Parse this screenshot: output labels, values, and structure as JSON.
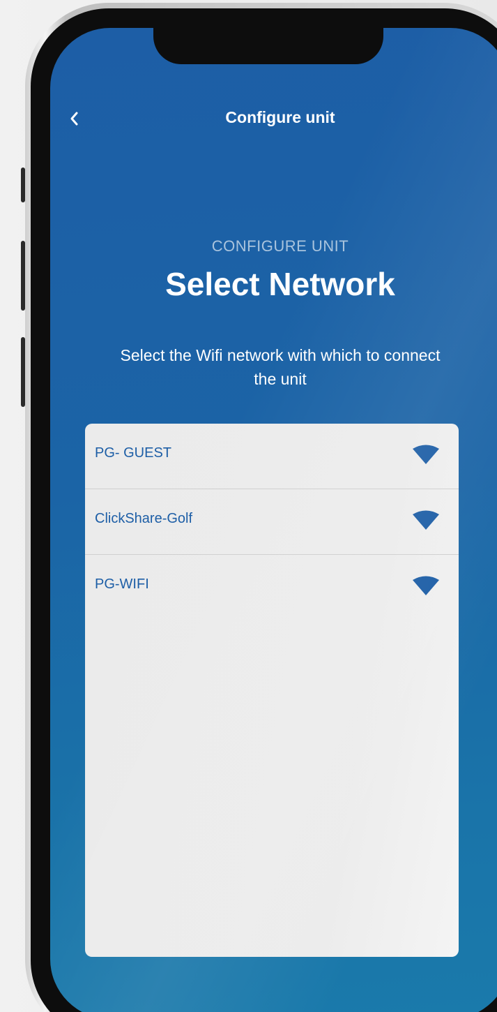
{
  "nav": {
    "back_icon": "chevron-left-icon",
    "title": "Configure unit"
  },
  "header": {
    "overline": "CONFIGURE UNIT",
    "heading": "Select Network",
    "description": "Select the Wifi network with which to connect the unit"
  },
  "networks": [
    {
      "name": "PG- GUEST",
      "icon": "wifi-icon"
    },
    {
      "name": "ClickShare-Golf",
      "icon": "wifi-icon"
    },
    {
      "name": "PG-WIFI",
      "icon": "wifi-icon"
    }
  ],
  "colors": {
    "screen_top": "#1d5ea6",
    "screen_bottom": "#1a7aab",
    "accent": "#1d5ea6",
    "panel": "#ececec"
  }
}
